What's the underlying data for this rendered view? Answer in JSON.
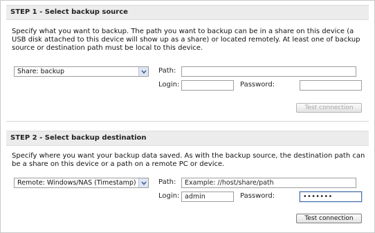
{
  "step1": {
    "header": "STEP 1 - Select backup source",
    "description": "Specify what you want to backup. The path you want to backup can be in a share on this device (a USB disk attached to this device will show up as a share) or located remotely. At least one of backup source or destination path must be local to this device.",
    "source_select": "Share: backup",
    "path_label": "Path:",
    "path_value": "",
    "login_label": "Login:",
    "login_value": "",
    "password_label": "Password:",
    "password_value": "",
    "test_button": "Test connection",
    "test_button_enabled": false
  },
  "step2": {
    "header": "STEP 2 - Select backup destination",
    "description": "Specify where you want your backup data saved. As with the backup source, the destination path can be a share on this device or a path on a remote PC or device.",
    "destination_select": "Remote: Windows/NAS (Timestamp)",
    "path_label": "Path:",
    "path_placeholder": "Example: //host/share/path",
    "login_label": "Login:",
    "login_value": "admin",
    "password_label": "Password:",
    "password_value": "•••••••",
    "test_button": "Test connection",
    "test_button_enabled": true
  },
  "icons": {
    "dropdown": "chevron-down-icon"
  },
  "colors": {
    "header_bg": "#ececec",
    "dropdown_arrow_bg": "#dfe6f2",
    "dropdown_arrow": "#3b5fa0"
  }
}
